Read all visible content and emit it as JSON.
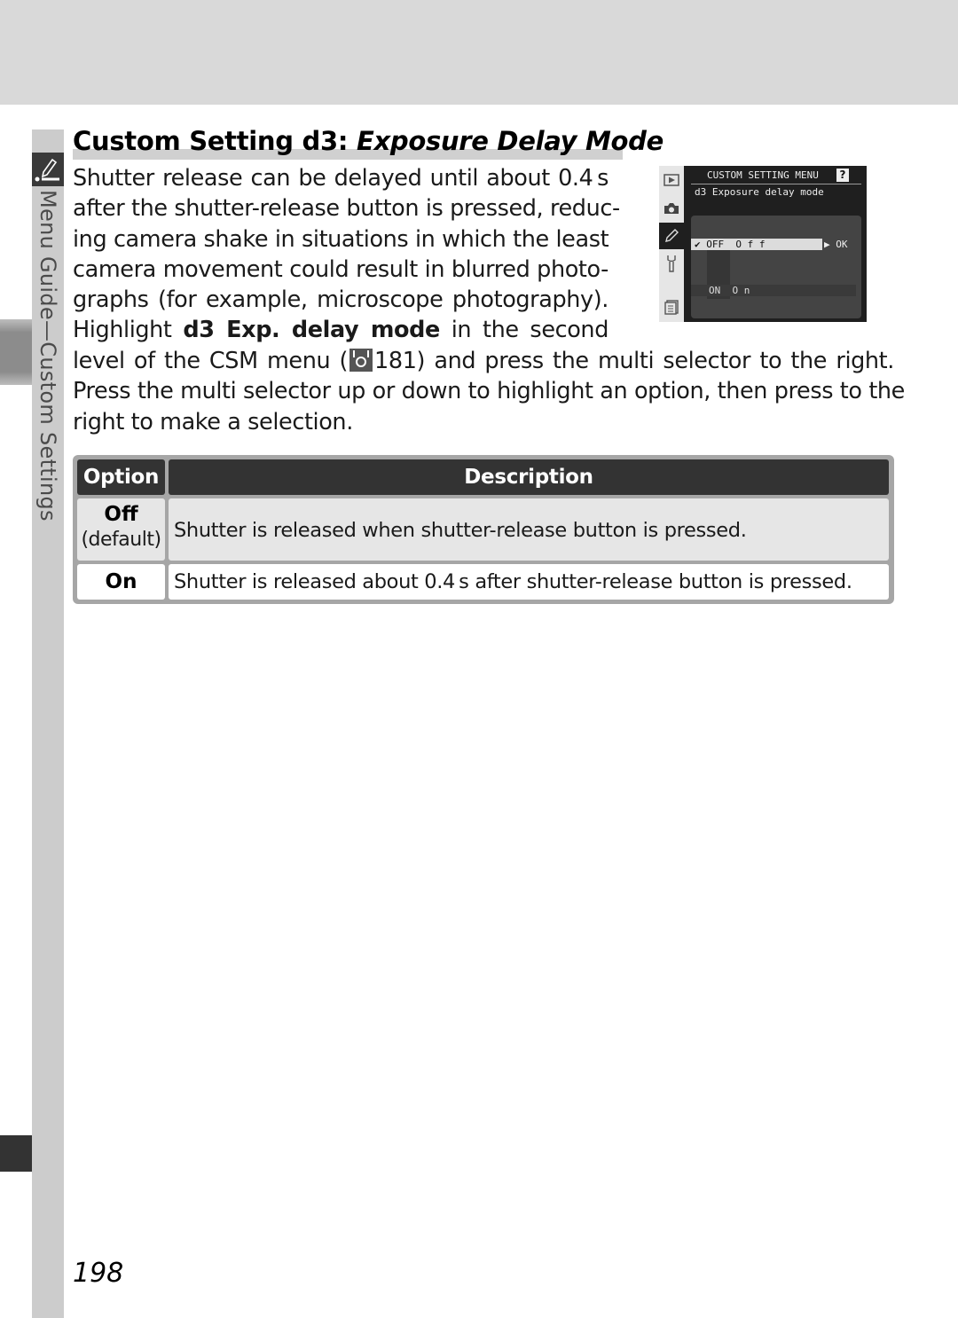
{
  "header": {
    "title_plain": "Custom Setting d3: ",
    "title_italic": "Exposure Delay Mode"
  },
  "sidebar": {
    "section_label": "Menu Guide—Custom Settings",
    "section_icon": "pencil-icon"
  },
  "body": {
    "narrow_lines": [
      "Shutter release can be delayed until about 0.4 s",
      "after the shutter-release button is pressed, reduc-",
      "ing camera shake in situations in which the least",
      "camera movement could result in blurred photo-",
      "graphs (for example, microscope photography)."
    ],
    "highlight_prefix": "Highlight ",
    "highlight_bold": "d3 Exp. delay mode",
    "highlight_suffix": " in the second",
    "wide_line1_prefix": "level of the CSM menu (",
    "ref_icon": "page-reference-icon",
    "ref_page": "181",
    "wide_line1_suffix": ") and press the multi selector to the right.",
    "wide_line2": "Press the multi selector up or down to highlight an option, then press to the",
    "wide_line3": "right to make a selection."
  },
  "camera_screen": {
    "menu_title": "CUSTOM SETTING MENU",
    "help_label": "?",
    "subtitle": "d3  Exposure delay mode",
    "options": [
      {
        "code": "OFF",
        "label": "O f f",
        "selected": true,
        "checked": true
      },
      {
        "code": "ON",
        "label": "O n",
        "selected": false,
        "checked": false
      }
    ],
    "ok_label": "▶ OK",
    "check_mark": "✔",
    "tabs": [
      "playback-icon",
      "camera-icon",
      "pencil-icon",
      "wrench-icon",
      "recent-settings-icon"
    ],
    "active_tab": "pencil-icon"
  },
  "table": {
    "headers": {
      "option": "Option",
      "description": "Description"
    },
    "rows": [
      {
        "option": "Off",
        "note": "(default)",
        "description": "Shutter is released when shutter-release button is pressed."
      },
      {
        "option": "On",
        "note": "",
        "description": "Shutter is released about 0.4 s after shutter-release button is pressed."
      }
    ]
  },
  "footer": {
    "page_number": "198"
  }
}
